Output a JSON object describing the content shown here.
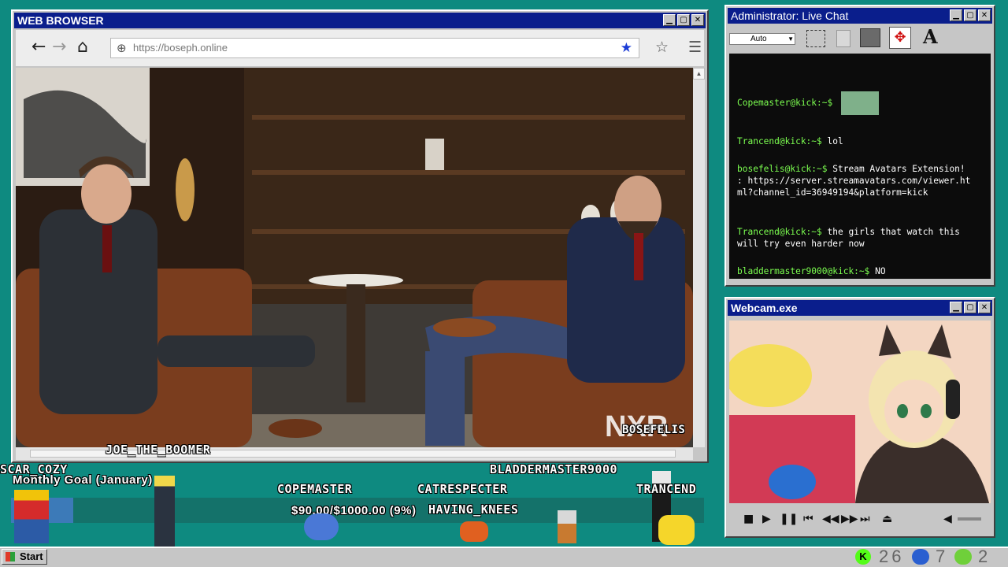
{
  "browser": {
    "title": "WEB BROWSER",
    "url": "https://boseph.online",
    "video_watermark": "BOSEFELIS",
    "nav_icons": [
      "back-arrow-icon",
      "forward-arrow-icon",
      "home-icon",
      "globe-icon",
      "star-filled-icon",
      "star-outline-icon",
      "hamburger-menu-icon"
    ]
  },
  "chat": {
    "title": "Administrator: Live Chat",
    "font_select": "Auto",
    "font_tool": "A",
    "messages": [
      {
        "user": "Copemaster@kick:~$",
        "text": ""
      },
      {
        "user": "Trancend@kick:~$",
        "text": "lol"
      },
      {
        "user": "bosefelis@kick:~$",
        "text": "Stream Avatars Extension! : https://server.streamavatars.com/viewer.html?channel_id=36949194&platform=kick"
      },
      {
        "user": "Trancend@kick:~$",
        "text": "the girls that watch this will try even harder now"
      },
      {
        "user": "bladdermaster9000@kick:~$",
        "text": "NO"
      }
    ]
  },
  "webcam": {
    "title": "Webcam.exe"
  },
  "goal": {
    "title": "Monthly Goal (January)",
    "amount": "$90.00/$1000.00 (9%)",
    "progress": 0.09
  },
  "avatars": {
    "joe": "JOE_THE_BOOMER",
    "scar": "SCAR_COZY",
    "copemaster": "COPEMASTER",
    "catrespecter": "CATRESPECTER",
    "bladdermaster": "BLADDERMASTER9000",
    "having": "HAVING_KNEES",
    "trancend": "TRANCEND"
  },
  "taskbar": {
    "start": "Start",
    "count1": "26",
    "count2": "7",
    "count3": "2"
  },
  "colors": {
    "desktop": "#0e8a80",
    "titlebar": "#0a1e8c",
    "chat_username": "#7cff50",
    "star": "#1a3bd6"
  }
}
